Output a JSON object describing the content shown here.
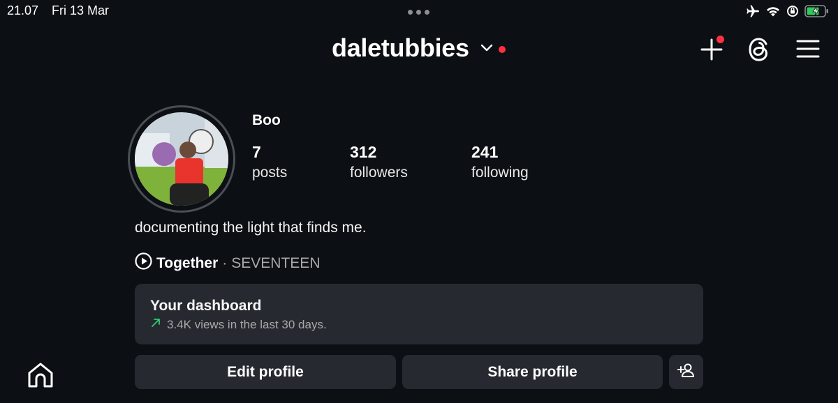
{
  "status_bar": {
    "time": "21.07",
    "date": "Fri 13 Mar",
    "icons": [
      "airplane-icon",
      "wifi-icon",
      "orientation-lock-icon",
      "battery-charging-icon"
    ]
  },
  "header": {
    "username": "daletubbies",
    "icons": [
      "chevron-down-icon",
      "notification-dot",
      "create-plus-icon",
      "threads-icon",
      "hamburger-menu-icon"
    ]
  },
  "profile": {
    "display_name": "Boo",
    "stats": [
      {
        "value": "7",
        "label": "posts"
      },
      {
        "value": "312",
        "label": "followers"
      },
      {
        "value": "241",
        "label": "following"
      }
    ],
    "bio": "documenting the light that finds me.",
    "music": {
      "song": "Together",
      "separator": "·",
      "artist": "SEVENTEEN"
    }
  },
  "dashboard": {
    "title": "Your dashboard",
    "subtitle": "3.4K views in the last 30 days."
  },
  "actions": {
    "edit_label": "Edit profile",
    "share_label": "Share profile"
  },
  "colors": {
    "background": "#0c1014",
    "card": "#262a30",
    "accent_red": "#ff3040",
    "trend_green": "#2ecc71"
  }
}
